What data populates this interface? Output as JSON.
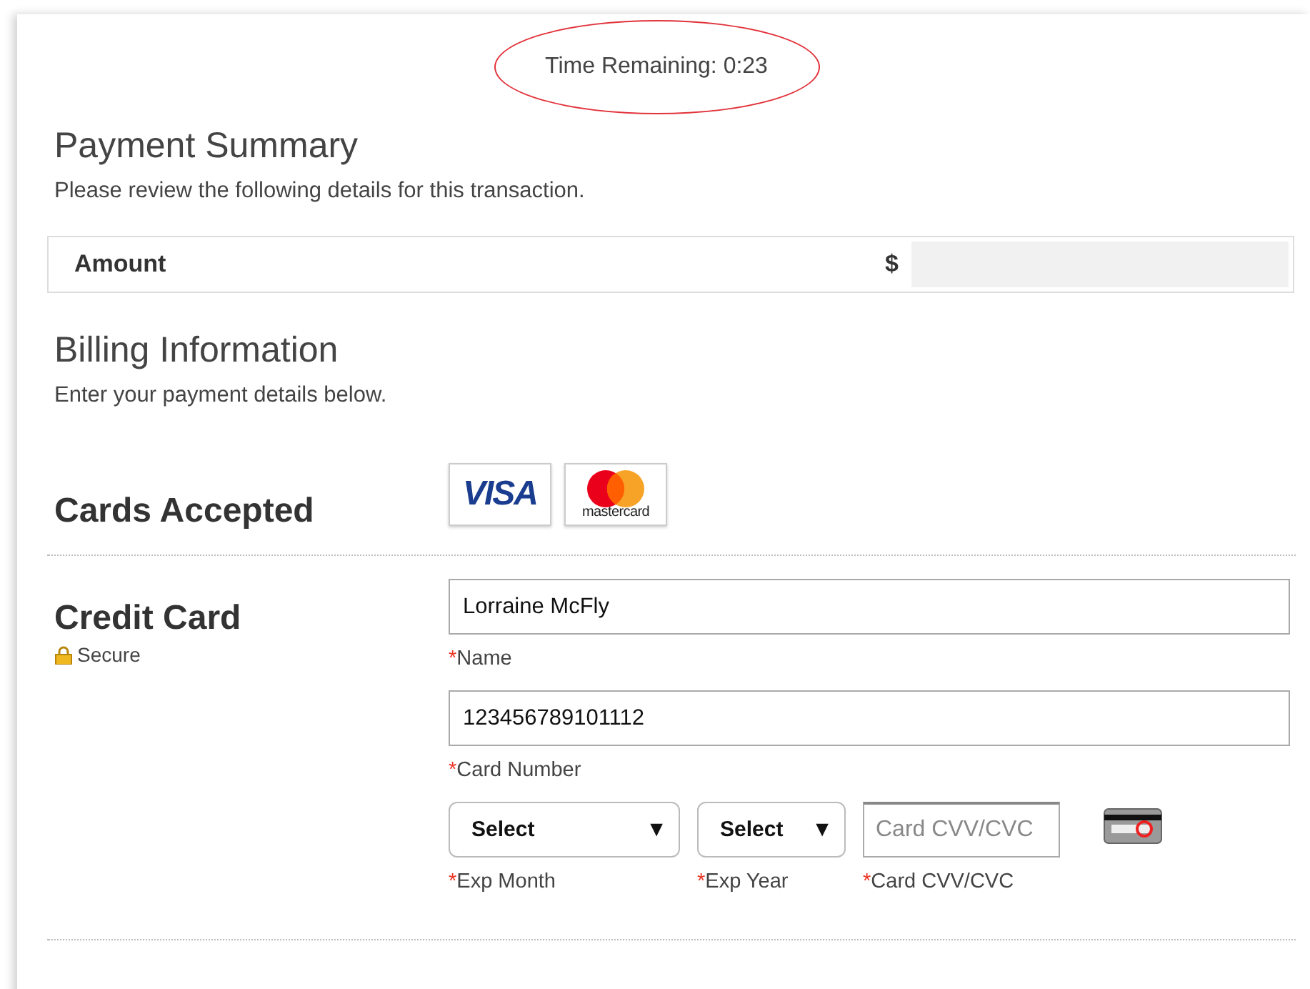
{
  "timer": {
    "text": "Time Remaining: 0:23",
    "circled": true
  },
  "payment_summary": {
    "title": "Payment Summary",
    "subtitle": "Please review the following details for this transaction.",
    "amount": {
      "label": "Amount",
      "currency": "$"
    }
  },
  "billing": {
    "title": "Billing Information",
    "subtitle": "Enter your payment details below."
  },
  "cards_accepted": {
    "label": "Cards Accepted",
    "cards": [
      {
        "kind": "visa",
        "text": "VISA"
      },
      {
        "kind": "mastercard",
        "text": "mastercard"
      }
    ]
  },
  "credit_card": {
    "label": "Credit Card",
    "secure": "Secure",
    "fields": [
      {
        "value": "Lorraine McFly",
        "mark": "*",
        "label": "Name"
      },
      {
        "value": "123456789101112",
        "mark": "*",
        "label": "Card Number"
      }
    ],
    "row": [
      {
        "kind": "select",
        "value": "Select",
        "arrow": "▼",
        "mark": "*",
        "label": "Exp Month"
      },
      {
        "kind": "select",
        "value": "Select",
        "arrow": "▼",
        "mark": "*",
        "label": "Exp Year"
      },
      {
        "kind": "input",
        "placeholder": "Card CVV/CVC",
        "mark": "*",
        "label": "Card CVV/CVC"
      }
    ]
  }
}
